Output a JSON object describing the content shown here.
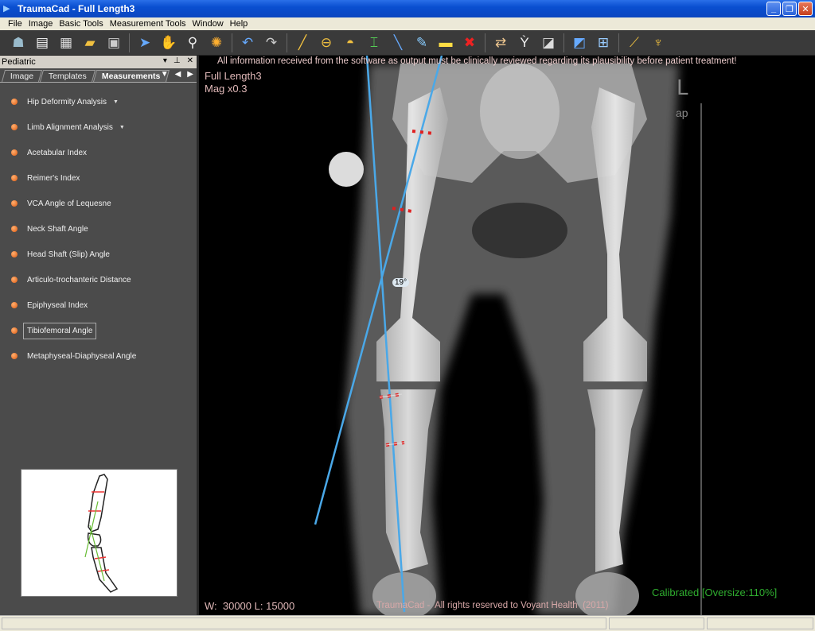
{
  "window": {
    "title": "TraumaCad - Full Length3"
  },
  "menu": [
    "File",
    "Image",
    "Basic Tools",
    "Measurement Tools",
    "Window",
    "Help"
  ],
  "toolbar_icons": [
    "patient-icon",
    "new-icon",
    "grid-icon",
    "open-icon",
    "save-icon",
    "pointer-icon",
    "pan-hand-icon",
    "zoom-icon",
    "brightness-icon",
    "undo-icon",
    "redo-icon",
    "line-ruler-icon",
    "circle-tool-icon",
    "arc-tool-icon",
    "caliper-icon",
    "straight-line-icon",
    "pen-icon",
    "note-icon",
    "delete-icon",
    "compare-icon",
    "bone-icon",
    "template-icon",
    "calibrate-icon",
    "layout-icon",
    "angle-icon",
    "hip-icon"
  ],
  "panel": {
    "title": "Pediatric",
    "tabs": [
      "Image",
      "Templates",
      "Measurements"
    ],
    "active_tab": "Measurements",
    "items": [
      {
        "label": "Hip Deformity Analysis",
        "has_submenu": true
      },
      {
        "label": "Limb Alignment Analysis",
        "has_submenu": true
      },
      {
        "label": "Acetabular Index"
      },
      {
        "label": "Reimer's Index"
      },
      {
        "label": "VCA Angle of Lequesne"
      },
      {
        "label": "Neck Shaft Angle"
      },
      {
        "label": "Head Shaft (Slip) Angle"
      },
      {
        "label": "Articulo-trochanteric Distance"
      },
      {
        "label": "Epiphyseal Index"
      },
      {
        "label": "Tibiofemoral Angle",
        "selected": true
      },
      {
        "label": "Metaphyseal-Diaphyseal Angle"
      }
    ]
  },
  "viewer": {
    "disclaimer": "All information received from the software as output must be clinically reviewed regarding its plausibility before patient treatment!",
    "image_name": "Full Length3",
    "magnification": "Mag x0.3",
    "side_marker": "L",
    "view_marker": "ap",
    "angle_label": "19°",
    "window_level": "W:  30000 L: 15000",
    "copyright": "TraumaCad -  All rights reserved to Voyant Health  (2011)",
    "calibration": "Calibrated [Oversize:110%]",
    "colors": {
      "measure_line": "#4aa8e8",
      "marker": "#e02020",
      "calibrated": "#2fae2f",
      "overlay_text": "#d8b0b0"
    }
  }
}
